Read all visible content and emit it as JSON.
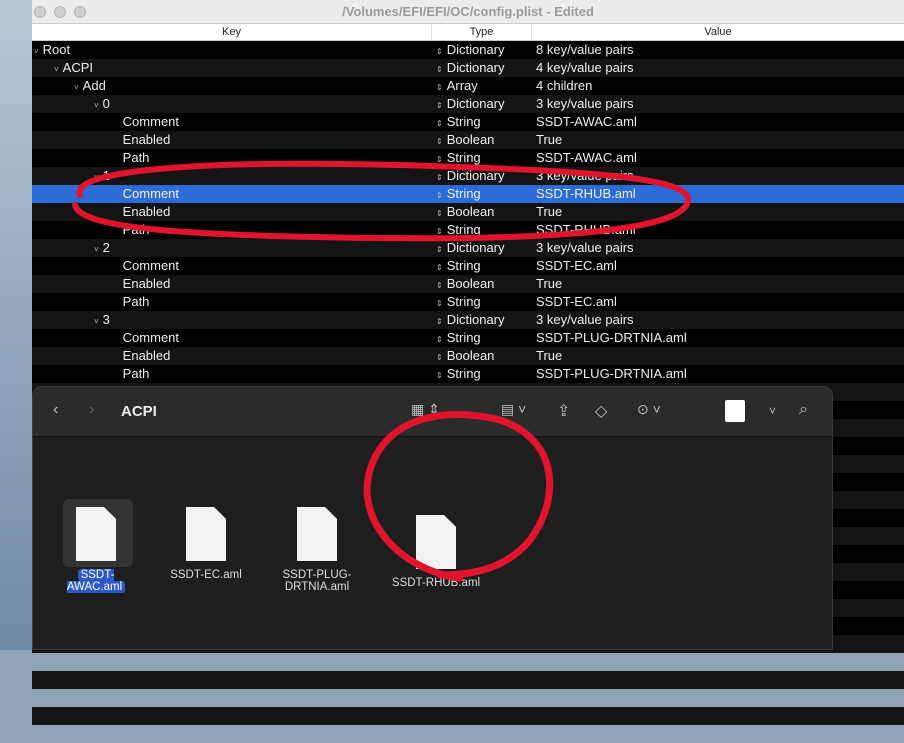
{
  "window": {
    "title": "/Volumes/EFI/EFI/OC/config.plist - Edited"
  },
  "columns": {
    "key": "Key",
    "type": "Type",
    "value": "Value"
  },
  "rows": [
    {
      "key": "Root",
      "indent": 0,
      "disclosure": true,
      "type": "Dictionary",
      "value": "8 key/value pairs"
    },
    {
      "key": "ACPI",
      "indent": 1,
      "disclosure": true,
      "type": "Dictionary",
      "value": "4 key/value pairs"
    },
    {
      "key": "Add",
      "indent": 2,
      "disclosure": true,
      "type": "Array",
      "value": "4 children"
    },
    {
      "key": "0",
      "indent": 3,
      "disclosure": true,
      "type": "Dictionary",
      "value": "3 key/value pairs"
    },
    {
      "key": "Comment",
      "indent": 4,
      "type": "String",
      "value": "SSDT-AWAC.aml"
    },
    {
      "key": "Enabled",
      "indent": 4,
      "type": "Boolean",
      "value": "True"
    },
    {
      "key": "Path",
      "indent": 4,
      "type": "String",
      "value": "SSDT-AWAC.aml"
    },
    {
      "key": "1",
      "indent": 3,
      "disclosure": true,
      "type": "Dictionary",
      "value": "3 key/value pairs"
    },
    {
      "key": "Comment",
      "indent": 4,
      "type": "String",
      "value": "SSDT-RHUB.aml",
      "selected": true
    },
    {
      "key": "Enabled",
      "indent": 4,
      "type": "Boolean",
      "value": "True"
    },
    {
      "key": "Path",
      "indent": 4,
      "type": "String",
      "value": "SSDT-RHUB.aml"
    },
    {
      "key": "2",
      "indent": 3,
      "disclosure": true,
      "type": "Dictionary",
      "value": "3 key/value pairs"
    },
    {
      "key": "Comment",
      "indent": 4,
      "type": "String",
      "value": "SSDT-EC.aml"
    },
    {
      "key": "Enabled",
      "indent": 4,
      "type": "Boolean",
      "value": "True"
    },
    {
      "key": "Path",
      "indent": 4,
      "type": "String",
      "value": "SSDT-EC.aml"
    },
    {
      "key": "3",
      "indent": 3,
      "disclosure": true,
      "type": "Dictionary",
      "value": "3 key/value pairs"
    },
    {
      "key": "Comment",
      "indent": 4,
      "type": "String",
      "value": "SSDT-PLUG-DRTNIA.aml"
    },
    {
      "key": "Enabled",
      "indent": 4,
      "type": "Boolean",
      "value": "True"
    },
    {
      "key": "Path",
      "indent": 4,
      "type": "String",
      "value": "SSDT-PLUG-DRTNIA.aml"
    }
  ],
  "finder": {
    "title": "ACPI",
    "files": [
      {
        "name": "SSDT-AWAC.aml",
        "selected": true
      },
      {
        "name": "SSDT-EC.aml"
      },
      {
        "name": "SSDT-PLUG-DRTNIA.aml"
      },
      {
        "name": "SSDT-RHUB.aml"
      }
    ]
  },
  "colors": {
    "selection": "#2d6cd6",
    "annotation": "#e0142c"
  }
}
